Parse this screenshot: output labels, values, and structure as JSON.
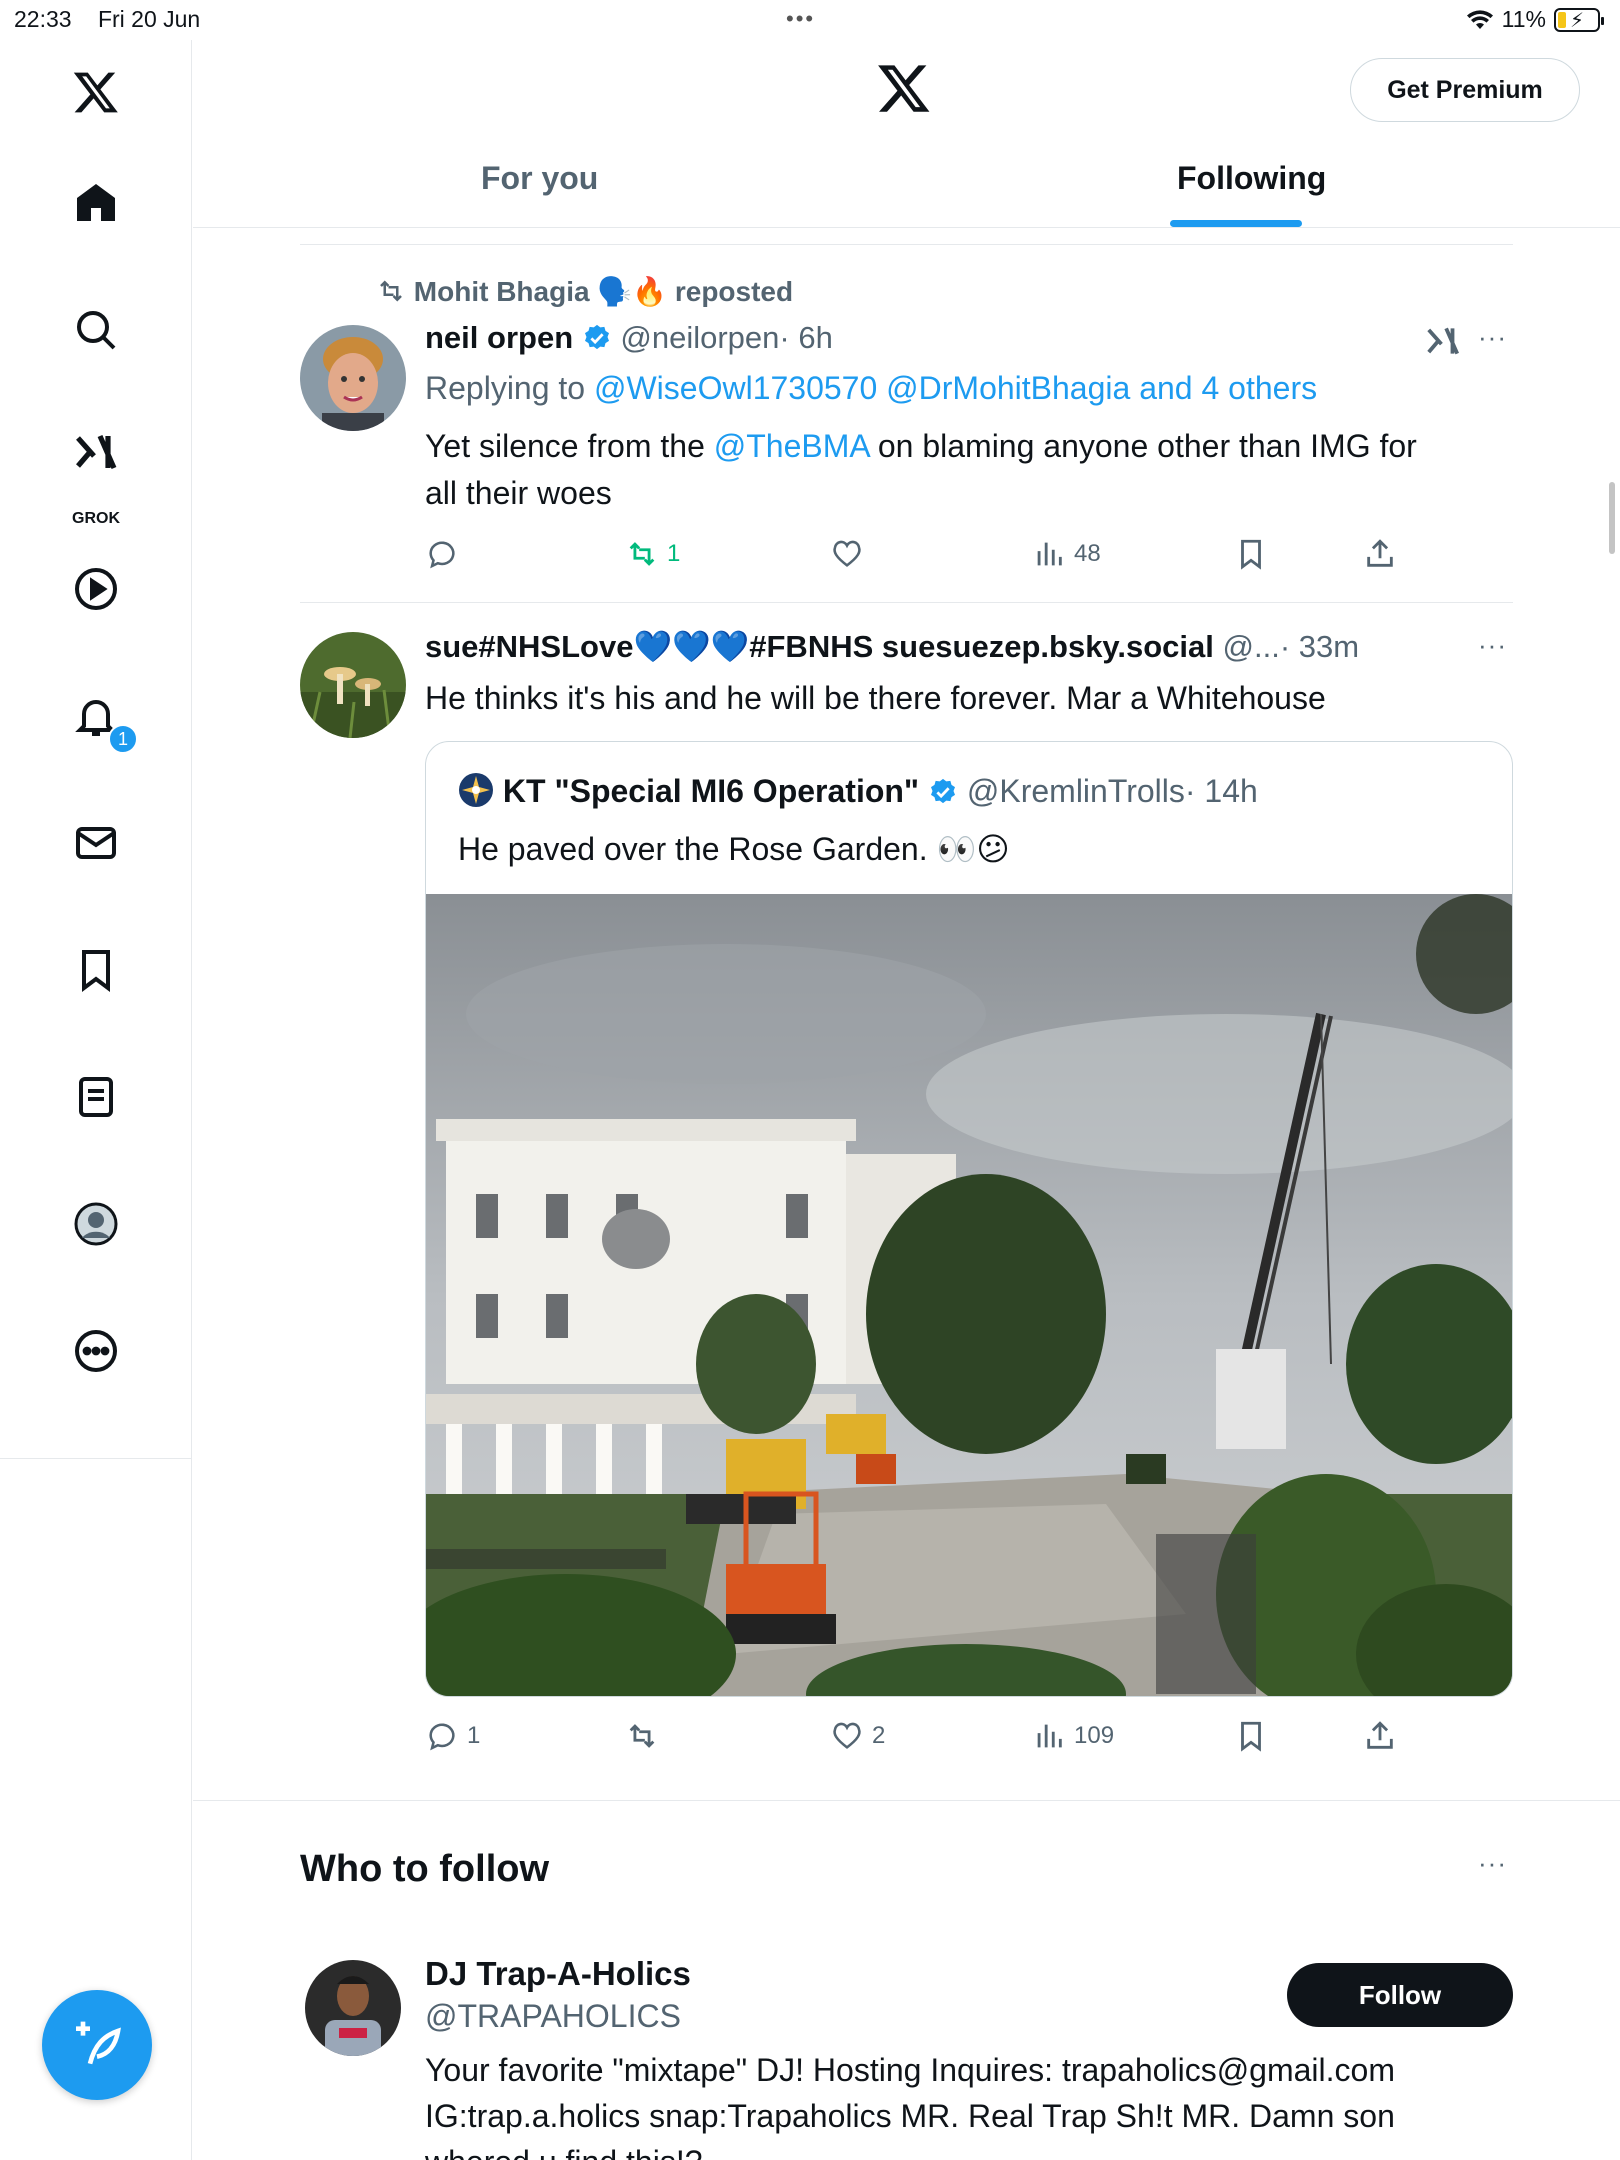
{
  "status_bar": {
    "time": "22:33",
    "date": "Fri 20 Jun",
    "battery": "11%"
  },
  "sidebar": {
    "items": [
      {
        "icon": "x-logo-icon"
      },
      {
        "icon": "home-icon"
      },
      {
        "icon": "search-icon"
      },
      {
        "icon": "grok-icon",
        "label": "GROK"
      },
      {
        "icon": "play-icon"
      },
      {
        "icon": "bell-icon",
        "badge": "1"
      },
      {
        "icon": "mail-icon"
      },
      {
        "icon": "bookmark-icon"
      },
      {
        "icon": "list-icon"
      },
      {
        "icon": "profile-icon"
      },
      {
        "icon": "more-icon"
      }
    ],
    "compose_icon": "compose-icon"
  },
  "header": {
    "premium_label": "Get Premium",
    "tabs": [
      {
        "label": "For you",
        "active": false
      },
      {
        "label": "Following",
        "active": true
      }
    ]
  },
  "tweets": [
    {
      "repost_by": "Mohit Bhagia 🗣️🔥",
      "repost_label": "reposted",
      "name": "neil orpen",
      "handle": "@neilorpen",
      "time": "· 6h",
      "replying_prefix": "Replying to",
      "replying_to": "@WiseOwl1730570 @DrMohitBhagia and 4 others",
      "text_before": "Yet silence from the",
      "text_mention": "@TheBMA",
      "text_after": "on blaming anyone other than IMG for",
      "text_line2": "all their woes",
      "reposts": "1",
      "views": "48"
    },
    {
      "name": "sue#NHSLove💙💙💙#FBNHS suesuezep.bsky.social",
      "handle": "@...",
      "time": "· 33m",
      "text": "He thinks it's his and he will be there forever. Mar a Whitehouse",
      "quote": {
        "name": "KT \"Special MI6 Operation\"",
        "handle": "@KremlinTrolls",
        "time": "· 14h",
        "text": "He paved over the Rose Garden. 👀😕"
      },
      "replies": "1",
      "likes": "2",
      "views": "109"
    }
  ],
  "who_to_follow": {
    "title": "Who to follow",
    "user": {
      "name": "DJ Trap-A-Holics",
      "handle": "@TRAPAHOLICS",
      "bio_line1": "Your favorite \"mixtape\" DJ! Hosting Inquires: trapaholics@gmail.com",
      "bio_line2": "IG:trap.a.holics snap:Trapaholics MR. Real Trap Sh!t MR. Damn son",
      "bio_line3": "whered u find this!?",
      "follow_label": "Follow"
    }
  },
  "colors": {
    "accent": "#1d9bf0",
    "text": "#0f1419",
    "muted": "#536471",
    "repost_green": "#00ba7c"
  }
}
